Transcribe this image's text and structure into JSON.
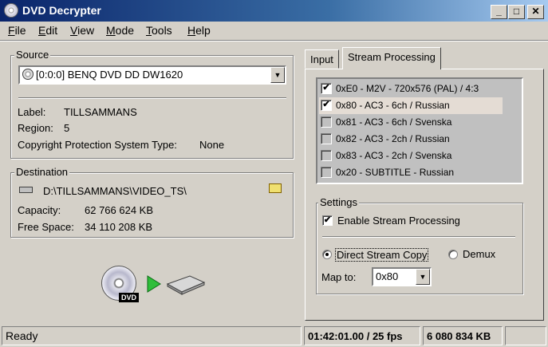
{
  "window": {
    "title": "DVD Decrypter"
  },
  "menu": [
    "File",
    "Edit",
    "View",
    "Mode",
    "Tools",
    "Help"
  ],
  "source": {
    "group_label": "Source",
    "drive": "[0:0:0] BENQ DVD DD DW1620",
    "label_key": "Label:",
    "label_value": "TILLSAMMANS",
    "region_key": "Region:",
    "region_value": "5",
    "cps_key": "Copyright Protection System Type:",
    "cps_value": "None"
  },
  "destination": {
    "group_label": "Destination",
    "path": "D:\\TILLSAMMANS\\VIDEO_TS\\",
    "capacity_key": "Capacity:",
    "capacity_value": "62 766 624 KB",
    "free_key": "Free Space:",
    "free_value": "34 110 208 KB"
  },
  "tabs": [
    "Input",
    "Stream Processing"
  ],
  "streams": [
    {
      "label": "0xE0 - M2V - 720x576 (PAL) / 4:3",
      "checked": true
    },
    {
      "label": "0x80 - AC3 - 6ch / Russian",
      "checked": true
    },
    {
      "label": "0x81 - AC3 - 6ch / Svenska",
      "checked": false
    },
    {
      "label": "0x82 - AC3 - 2ch / Russian",
      "checked": false
    },
    {
      "label": "0x83 - AC3 - 2ch / Svenska",
      "checked": false
    },
    {
      "label": "0x20 - SUBTITLE - Russian",
      "checked": false
    }
  ],
  "settings": {
    "group_label": "Settings",
    "enable_label": "Enable Stream Processing",
    "direct_label": "Direct Stream Copy",
    "demux_label": "Demux",
    "mapto_label": "Map to:",
    "mapto_value": "0x80"
  },
  "status": {
    "state": "Ready",
    "time": "01:42:01.00 / 25 fps",
    "size": "6 080 834 KB"
  },
  "icons": {
    "dvd_badge": "DVD",
    "check": "✔"
  }
}
